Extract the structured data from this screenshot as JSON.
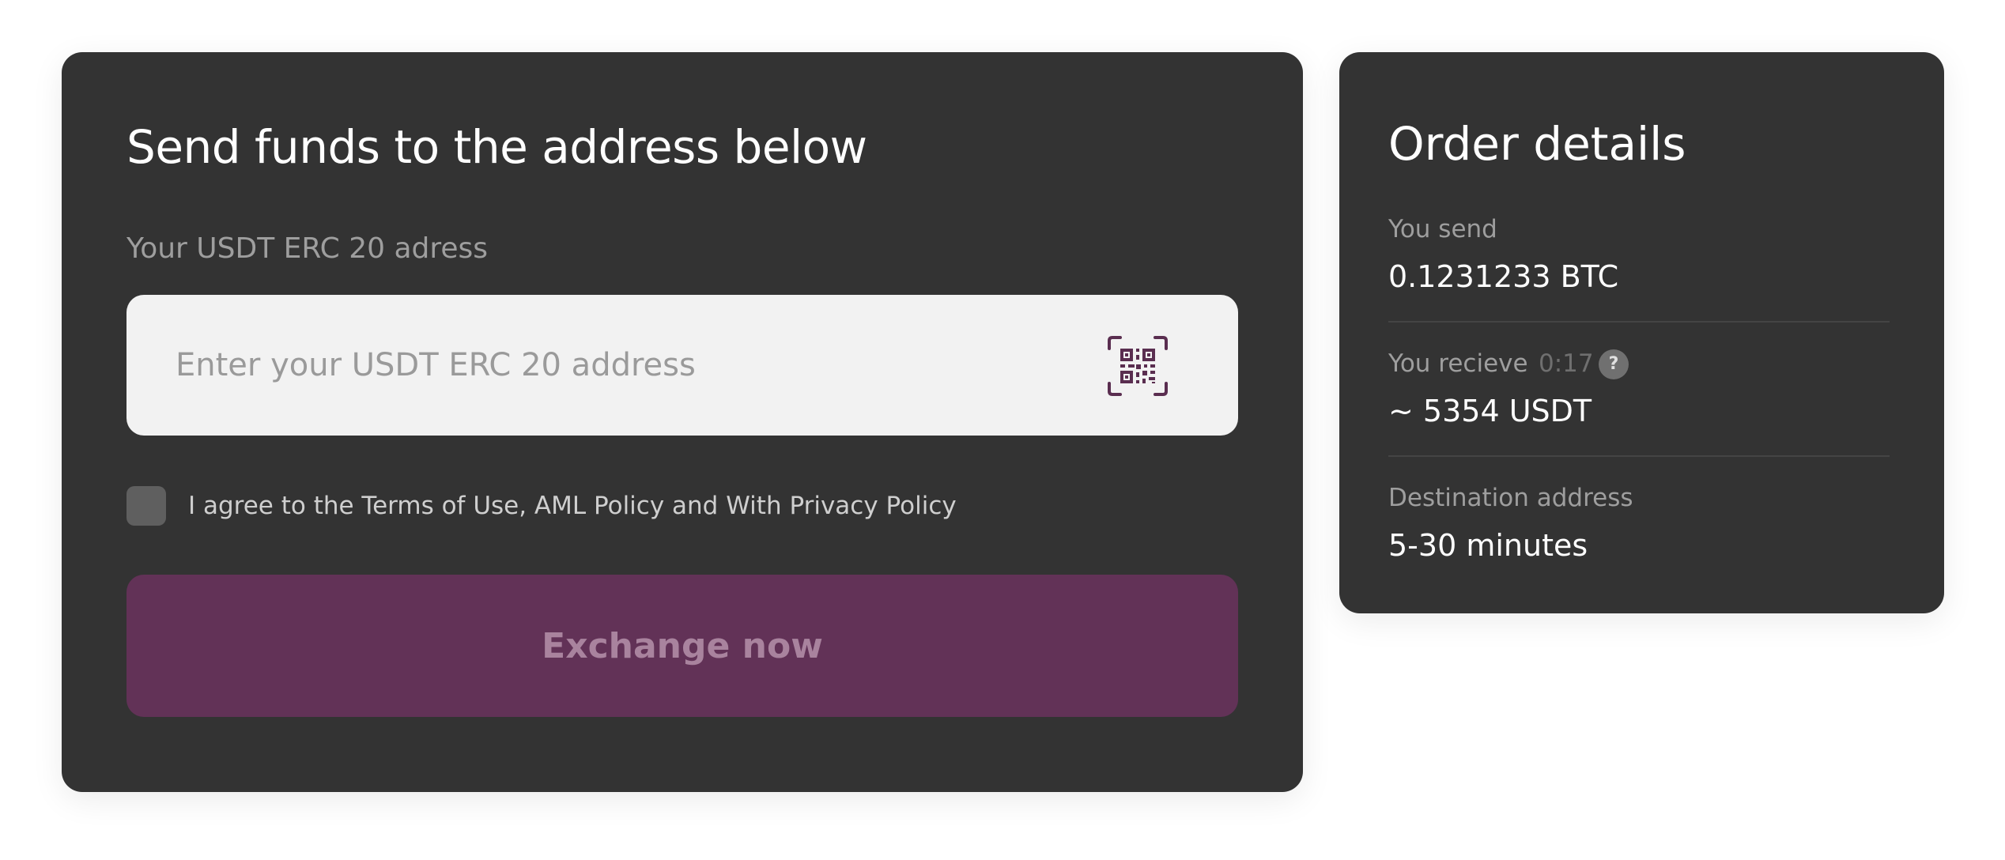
{
  "send_panel": {
    "title": "Send funds to the address below",
    "address_label": "Your USDT ERC 20 adress",
    "address_placeholder": "Enter your USDT ERC 20 address",
    "address_value": "",
    "qr_icon": "qr-scan-icon",
    "agree_text": "I agree to the Terms of Use, AML Policy and With Privacy Policy",
    "agree_checked": false,
    "exchange_label": "Exchange now",
    "exchange_color": "#623257"
  },
  "order": {
    "title": "Order details",
    "send_label": "You send",
    "send_value": "0.1231233 BTC",
    "receive_label": "You recieve",
    "receive_timer": "0:17",
    "help_icon_glyph": "?",
    "receive_value": "~ 5354 USDT",
    "destination_label": "Destination address",
    "destination_value": "5-30 minutes"
  },
  "colors": {
    "card_background": "#333333",
    "page_background": "#ffffff",
    "accent": "#623257"
  }
}
